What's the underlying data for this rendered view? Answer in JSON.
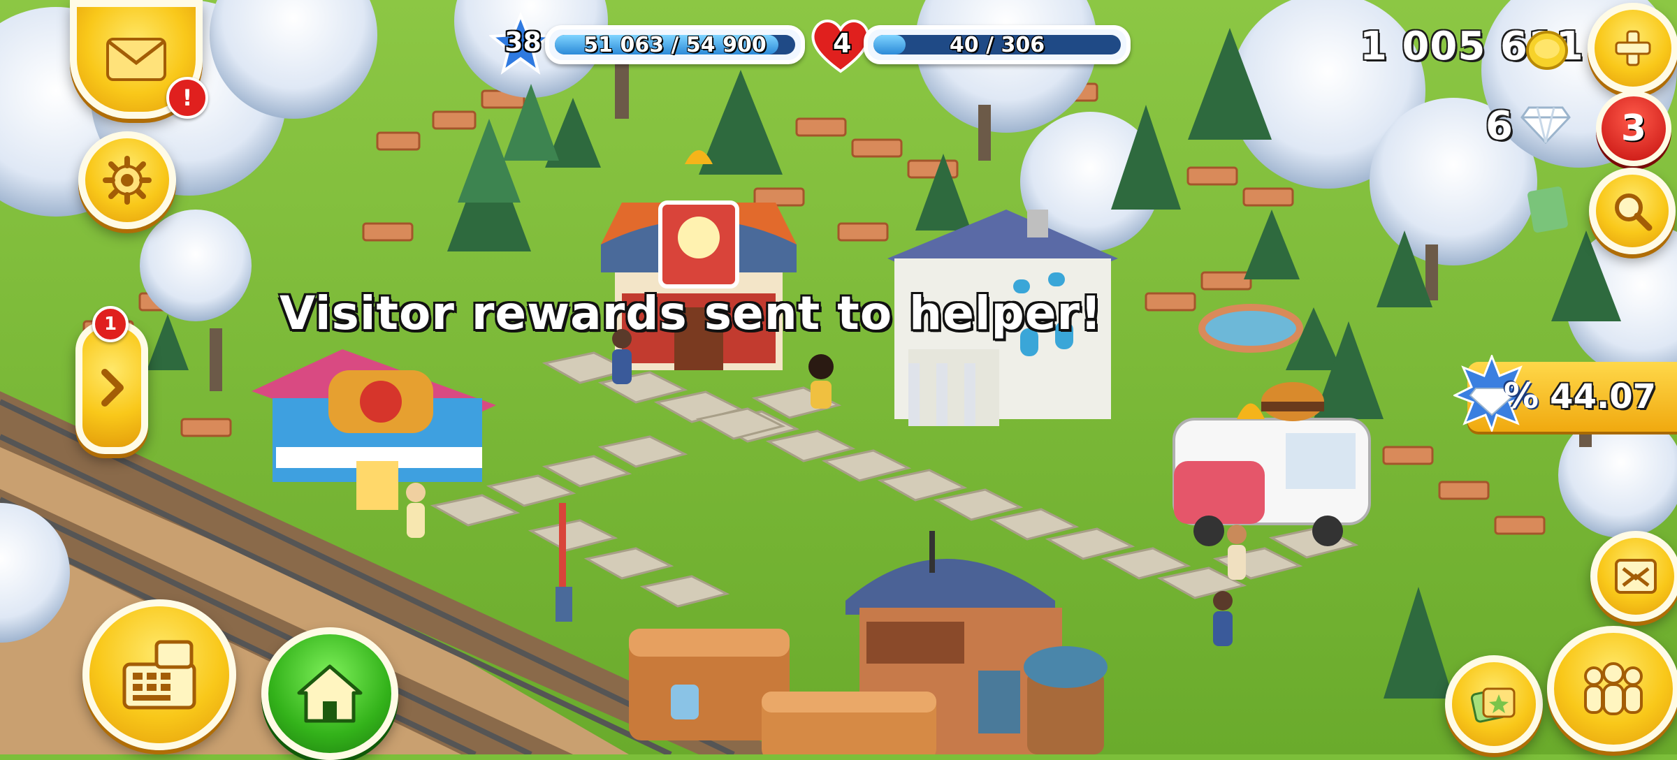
{
  "level": {
    "value": "38",
    "xp_text": "51 063 / 54 900",
    "progress": 0.93
  },
  "health": {
    "value": "4",
    "text": "40 / 306",
    "progress": 0.13
  },
  "coins": {
    "value": "1 005 611"
  },
  "diamonds": {
    "value": "6"
  },
  "mail": {
    "badge": "!"
  },
  "expand_panel": {
    "badge": "1"
  },
  "diamond_button": {
    "badge": "3"
  },
  "message": {
    "text": "Visitor rewards sent to helper!"
  },
  "offer": {
    "value": "44.07",
    "badge": "%"
  },
  "icons": {
    "mail": "envelope-icon",
    "settings": "gear-icon",
    "expand": "chevron-right-icon",
    "shop": "cash-register-icon",
    "home": "house-icon",
    "add": "plus-icon",
    "search": "magnifier-icon",
    "expand_map": "expand-arrows-icon",
    "friends": "people-icon",
    "cards": "cards-icon"
  },
  "colors": {
    "accent": "#f9c81a",
    "alert": "#e0201e",
    "grass": "#7cbf3a",
    "home": "#3bbd2a"
  }
}
